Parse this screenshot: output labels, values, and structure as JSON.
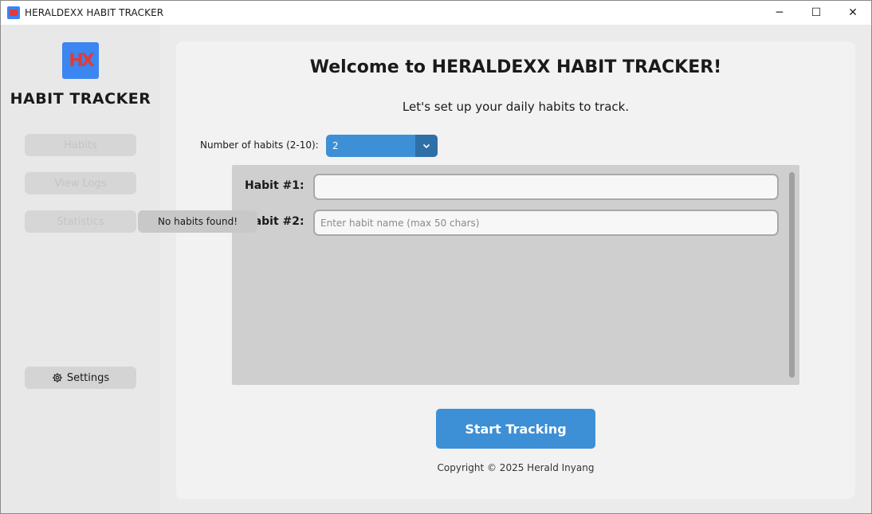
{
  "window": {
    "title": "HERALDEXX HABIT TRACKER",
    "controls": {
      "minimize": "─",
      "maximize": "☐",
      "close": "✕"
    }
  },
  "sidebar": {
    "logo_text": "HX",
    "title": "HABIT TRACKER",
    "items": [
      {
        "label": "Habits"
      },
      {
        "label": "View Logs"
      },
      {
        "label": "Statistics"
      }
    ],
    "settings_label": "Settings",
    "tooltip": "No habits found!"
  },
  "main": {
    "welcome": "Welcome to HERALDEXX HABIT TRACKER!",
    "subtitle": "Let's set up your daily habits to track.",
    "count_label": "Number of habits (2-10):",
    "count_value": "2",
    "habits": [
      {
        "label": "Habit #1:",
        "value": "",
        "placeholder": ""
      },
      {
        "label": "Habit #2:",
        "value": "",
        "placeholder": "Enter habit name (max 50 chars)"
      }
    ],
    "start_label": "Start Tracking",
    "copyright": "Copyright © 2025 Herald Inyang"
  },
  "colors": {
    "accent": "#3d8fd6",
    "accent_dark": "#2f6fa8",
    "logo_bg": "#3b86f0",
    "logo_fg": "#e53935"
  }
}
